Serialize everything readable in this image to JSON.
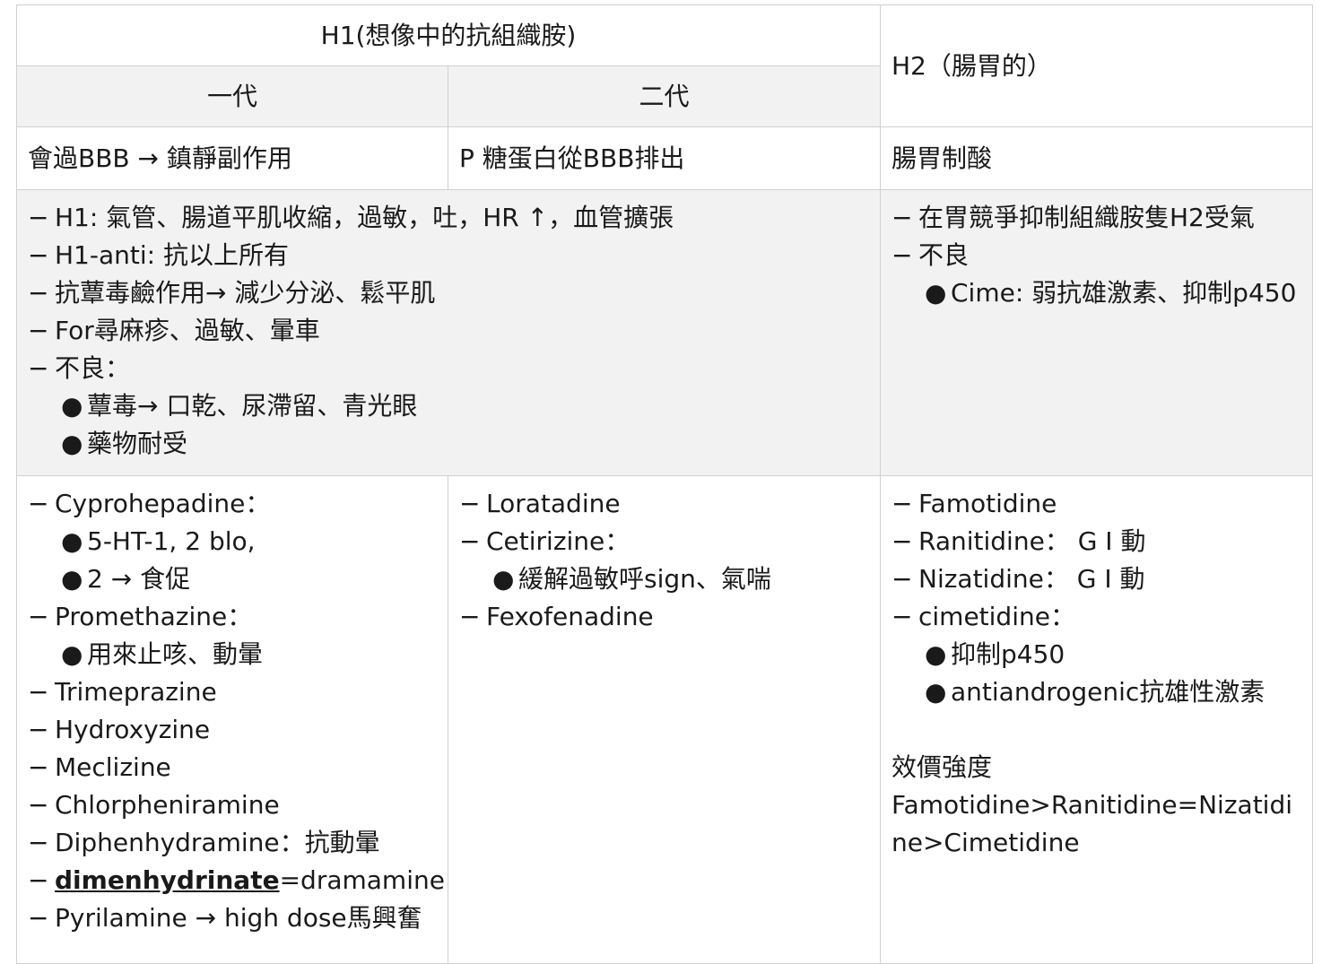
{
  "header": {
    "h1": "H1(想像中的抗組織胺)",
    "h2": "H2（腸胃的）",
    "gen1": "一代",
    "gen2": "二代"
  },
  "row_summary": {
    "gen1": "會過BBB → 鎮靜副作用",
    "gen2": "P 糖蛋白從BBB排出",
    "h2": "腸胃制酸"
  },
  "row_effects": {
    "h1": {
      "l1": "H1: 氣管、腸道平肌收縮，過敏，吐，HR ↑，血管擴張",
      "l2": " H1-anti: 抗以上所有",
      "l3": "抗蕈毒鹼作用→ 減少分泌、鬆平肌",
      "l4": "For尋麻疹、過敏、暈車",
      "l5": "不良：",
      "b1": "蕈毒→ 口乾、尿滯留、青光眼",
      "b2": "藥物耐受"
    },
    "h2": {
      "l1": "在胃競爭抑制組織胺隻H2受氣",
      "l2": "不良",
      "b1": "Cime: 弱抗雄激素、抑制p450"
    }
  },
  "row_drugs": {
    "gen1": {
      "d1": "Cyprohepadine：",
      "d1_b1": " 5-HT-1, 2 blo,",
      "d1_b2": "2 →  食促",
      "d2": "Promethazine：",
      "d2_b1": "用來止咳、動暈",
      "d3": "Trimeprazine",
      "d4": "Hydroxyzine",
      "d5": "Meclizine",
      "d6": "Chlorpheniramine",
      "d7": "Diphenhydramine：抗動暈",
      "d8_bold": "dimenhydrinate",
      "d8_rest": "=dramamine",
      "d9": "Pyrilamine → high dose馬興奮"
    },
    "gen2": {
      "d1": "Loratadine",
      "d2": "Cetirizine：",
      "d2_b1": "緩解過敏呼sign、氣喘",
      "d3": "Fexofenadine"
    },
    "h2": {
      "d1": "Famotidine",
      "d2": "Ranitidine：  G I 動",
      "d3": "Nizatidine：  G I 動",
      "d4": "cimetidine：",
      "d4_b1": "抑制p450",
      "d4_b2": "antiandrogenic抗雄性激素",
      "potency_title": "效價強度",
      "potency": "Famotidine>Ranitidine=Nizatidine>Cimetidine"
    }
  },
  "symbols": {
    "dash": "−",
    "dot": "●"
  }
}
